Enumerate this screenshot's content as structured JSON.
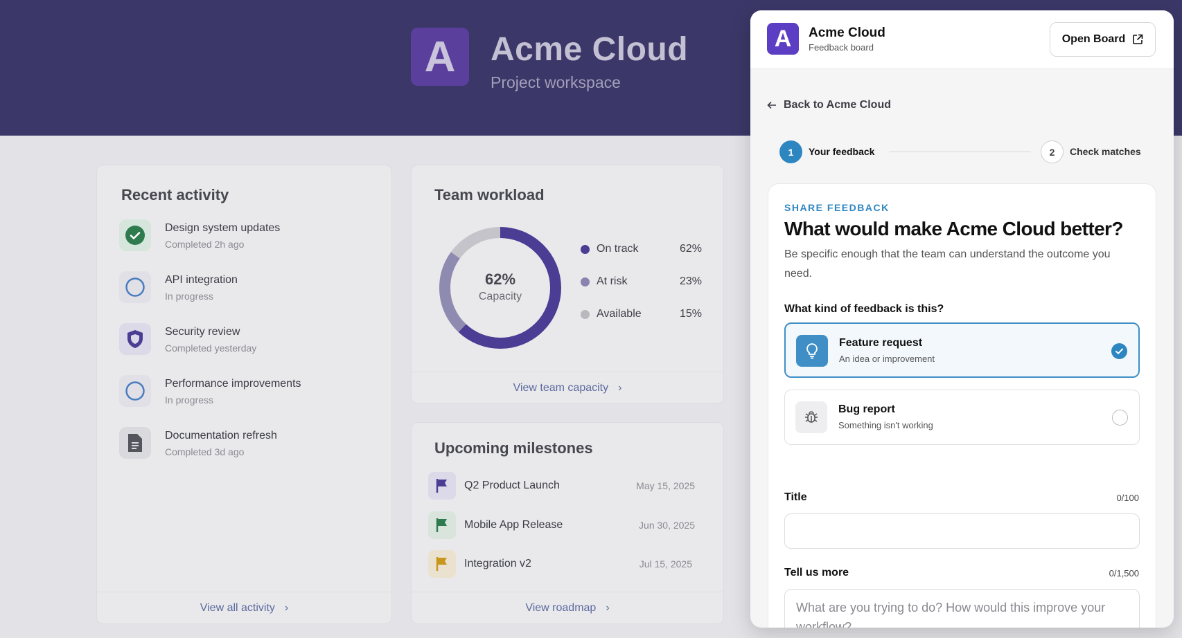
{
  "workspace": {
    "logo_letter": "A",
    "title": "Acme Cloud",
    "subtitle": "Project workspace"
  },
  "recent_activity": {
    "title": "Recent activity",
    "items": [
      {
        "name": "Design system updates",
        "status": "Completed 2h ago",
        "icon": "check-circle-icon"
      },
      {
        "name": "API integration",
        "status": "In progress",
        "icon": "progress-ring-icon"
      },
      {
        "name": "Security review",
        "status": "Completed yesterday",
        "icon": "shield-icon"
      },
      {
        "name": "Performance improvements",
        "status": "In progress",
        "icon": "progress-ring-icon"
      },
      {
        "name": "Documentation refresh",
        "status": "Completed 3d ago",
        "icon": "document-icon"
      }
    ],
    "footer_link": "View all activity"
  },
  "team_workload": {
    "title": "Team workload",
    "center_value": "62%",
    "center_label": "Capacity",
    "legend": [
      {
        "label": "On track",
        "value": "62%",
        "color": "#4b3c94"
      },
      {
        "label": "At risk",
        "value": "23%",
        "color": "#8a83b0"
      },
      {
        "label": "Available",
        "value": "15%",
        "color": "#b8b8be"
      }
    ],
    "segments": [
      {
        "fraction": 0.62,
        "color": "#4b3c94"
      },
      {
        "fraction": 0.23,
        "color": "#8f8ab0"
      },
      {
        "fraction": 0.15,
        "color": "#c4c4ca"
      }
    ],
    "footer_link": "View team capacity"
  },
  "milestones": {
    "title": "Upcoming milestones",
    "items": [
      {
        "name": "Q2 Product Launch",
        "date": "May 15, 2025",
        "flag_color": "#4b3c94",
        "bg": "#dcd9e8"
      },
      {
        "name": "Mobile App Release",
        "date": "Jun 30, 2025",
        "flag_color": "#2e7b4e",
        "bg": "#d8e4dc"
      },
      {
        "name": "Integration v2",
        "date": "Jul 15, 2025",
        "flag_color": "#c8961c",
        "bg": "#eae2cf"
      }
    ],
    "footer_link": "View roadmap"
  },
  "panel": {
    "logo_letter": "A",
    "app_name": "Acme Cloud",
    "app_sub": "Feedback board",
    "open_board_label": "Open Board",
    "back_label": "Back to Acme Cloud",
    "steps": [
      {
        "number": "1",
        "label": "Your feedback",
        "active": true
      },
      {
        "number": "2",
        "label": "Check matches",
        "active": false
      }
    ],
    "eyebrow": "SHARE FEEDBACK",
    "title": "What would make Acme Cloud better?",
    "description": "Be specific enough that the team can understand the outcome you need.",
    "question": "What kind of feedback is this?",
    "options": [
      {
        "title": "Feature request",
        "subtitle": "An idea or improvement",
        "icon": "lightbulb-icon",
        "selected": true
      },
      {
        "title": "Bug report",
        "subtitle": "Something isn't working",
        "icon": "bug-icon",
        "selected": false
      }
    ],
    "title_field": {
      "label": "Title",
      "count": "0/100",
      "value": "",
      "placeholder": ""
    },
    "details_field": {
      "label": "Tell us more",
      "count": "0/1,500",
      "placeholder": "What are you trying to do? How would this improve your workflow?"
    }
  },
  "colors": {
    "accent_blue": "#3f8fc6",
    "brand_purple": "#5c3ec4"
  }
}
